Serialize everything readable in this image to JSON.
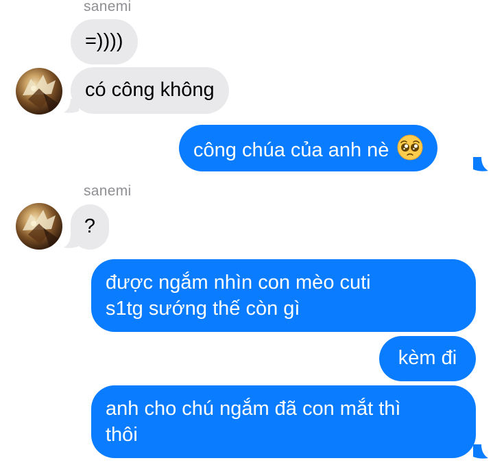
{
  "conversation": {
    "groups": [
      {
        "sender": "sanemi",
        "messages": [
          "=))))",
          "có công không"
        ]
      },
      {
        "sender": "sanemi",
        "messages": [
          "?"
        ]
      }
    ],
    "outgoing": {
      "m1_text": "công chúa của anh nè",
      "m1_emoji": "pleading-face",
      "m2_line1": "được ngắm nhìn con mèo cuti",
      "m2_line2": "s1tg sướng thế còn gì",
      "m3": "kèm đi",
      "m4_line1": "anh cho chú ngắm đã con mắt thì",
      "m4_line2": "thôi"
    }
  },
  "colors": {
    "incoming_bubble": "#e9e9eb",
    "outgoing_bubble": "#0a7cff",
    "sender_name": "#8e8e93"
  },
  "icons": {
    "avatar": "profile-avatar-image",
    "emoji": "pleading-face-emoji"
  }
}
